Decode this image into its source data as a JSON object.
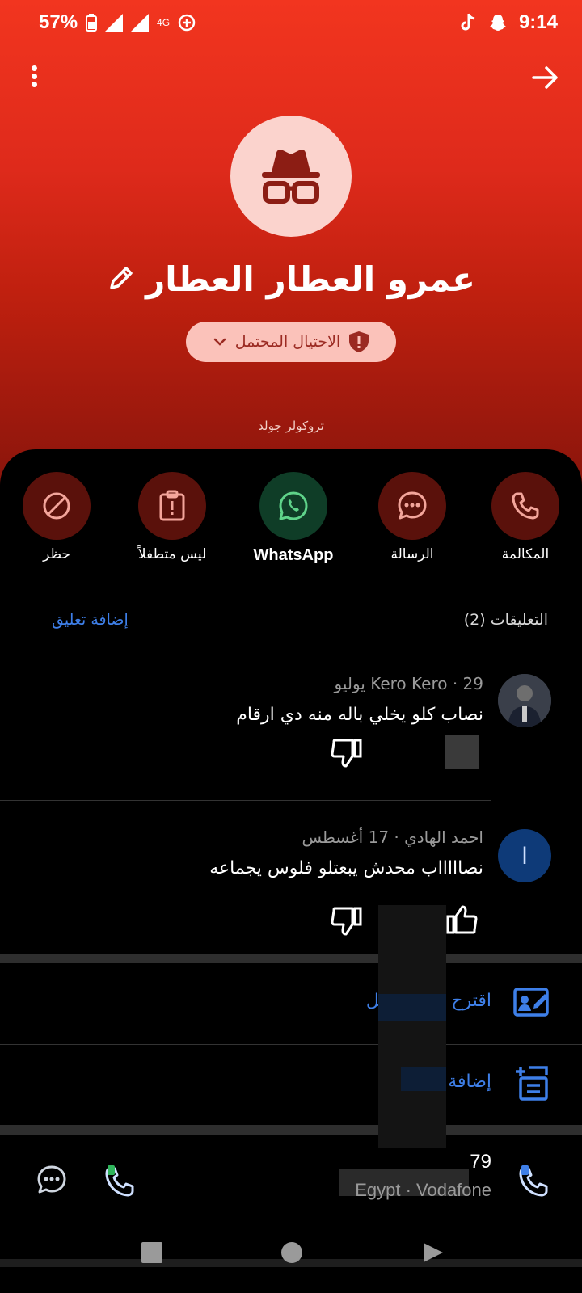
{
  "status": {
    "battery": "57%",
    "network": "4G",
    "time": "9:14"
  },
  "contact": {
    "name": "عمرو العطار العطار",
    "tag": "الاحتيال المحتمل",
    "gold_label": "تروكولر جولد"
  },
  "actions": [
    {
      "label": "المكالمة",
      "icon": "phone-icon"
    },
    {
      "label": "الرسالة",
      "icon": "chat-icon"
    },
    {
      "label": "WhatsApp",
      "icon": "whatsapp-icon"
    },
    {
      "label": "ليس متطفلاً",
      "icon": "not-spam-icon"
    },
    {
      "label": "حظر",
      "icon": "block-icon"
    }
  ],
  "comments_section": {
    "title": "التعليقات (2)",
    "add_label": "إضافة تعليق"
  },
  "comments": [
    {
      "author": "Kero Kero",
      "date": "29 يوليو",
      "text": "نصاب كلو يخلي باله منه دي ارقام"
    },
    {
      "author": "احمد الهادي",
      "date": "17 أغسطس",
      "text": "نصاااااب محدش يبعتلو فلوس يجماعه",
      "avatar_letter": "ا"
    }
  ],
  "suggest_label": "اقترح اسم أفضل",
  "add_label": "إضافة",
  "phone": {
    "number": "79",
    "carrier": "Egypt · Vodafone"
  },
  "colors": {
    "accent": "#3e7fe8",
    "header_top": "#f2351f",
    "pill_bg": "#fbc2ba",
    "whatsapp_bg": "#0f3d27"
  }
}
